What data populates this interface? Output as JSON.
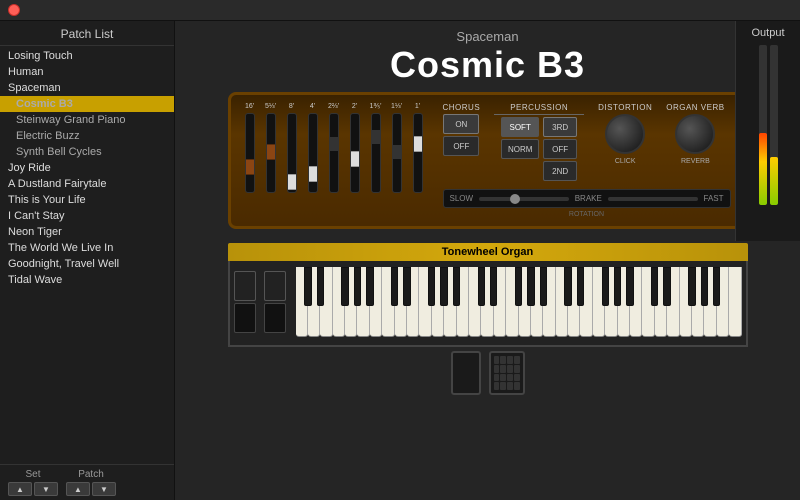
{
  "app": {
    "title": "Spaceman",
    "preset_name": "Cosmic B3",
    "sidebar_title": "Patch List"
  },
  "patch_list": {
    "items": [
      {
        "label": "Losing Touch",
        "type": "group",
        "selected": false
      },
      {
        "label": "Human",
        "type": "group",
        "selected": false
      },
      {
        "label": "Spaceman",
        "type": "group",
        "selected": false
      },
      {
        "label": "Cosmic B3",
        "type": "sub",
        "selected": true
      },
      {
        "label": "Steinway Grand Piano",
        "type": "sub",
        "selected": false
      },
      {
        "label": "Electric Buzz",
        "type": "sub",
        "selected": false
      },
      {
        "label": "Synth Bell Cycles",
        "type": "sub",
        "selected": false
      },
      {
        "label": "Joy Ride",
        "type": "group",
        "selected": false
      },
      {
        "label": "A Dustland Fairytale",
        "type": "group",
        "selected": false
      },
      {
        "label": "This is Your Life",
        "type": "group",
        "selected": false
      },
      {
        "label": "I Can't Stay",
        "type": "group",
        "selected": false
      },
      {
        "label": "Neon Tiger",
        "type": "group",
        "selected": false
      },
      {
        "label": "The World We Live In",
        "type": "group",
        "selected": false
      },
      {
        "label": "Goodnight, Travel Well",
        "type": "group",
        "selected": false
      },
      {
        "label": "Tidal Wave",
        "type": "group",
        "selected": false
      }
    ]
  },
  "footer": {
    "set_label": "Set",
    "patch_label": "Patch",
    "up_symbol": "▲",
    "down_symbol": "▼"
  },
  "controls": {
    "chorus": {
      "title": "CHORUS",
      "on_label": "ON",
      "off_label": "OFF"
    },
    "percussion": {
      "title": "PERCUSSION",
      "soft_label": "SOFT",
      "norm_label": "NORM",
      "3rd_label": "3RD",
      "off_label": "OFF",
      "2nd_label": "2ND"
    },
    "distortion": {
      "title": "DISTORTION",
      "click_label": "CLICK"
    },
    "organ_verb": {
      "title": "ORGAN VERB",
      "reverb_label": "REVERB"
    }
  },
  "rotation": {
    "slow_label": "SLOW",
    "brake_label": "BRAKE",
    "fast_label": "FAST",
    "rotation_label": "ROTATION"
  },
  "keyboard": {
    "label": "Tonewheel Organ"
  },
  "output": {
    "title": "Output"
  },
  "drawbars": {
    "labels": [
      "16'",
      "5⅓'",
      "8'",
      "4'",
      "2⅔'",
      "2'",
      "1⅗'",
      "1⅓'",
      "1'"
    ],
    "positions": [
      6,
      4,
      8,
      7,
      3,
      5,
      2,
      4,
      3
    ],
    "colors": [
      "brown",
      "brown",
      "white",
      "white",
      "black",
      "white",
      "black",
      "black",
      "white"
    ]
  }
}
